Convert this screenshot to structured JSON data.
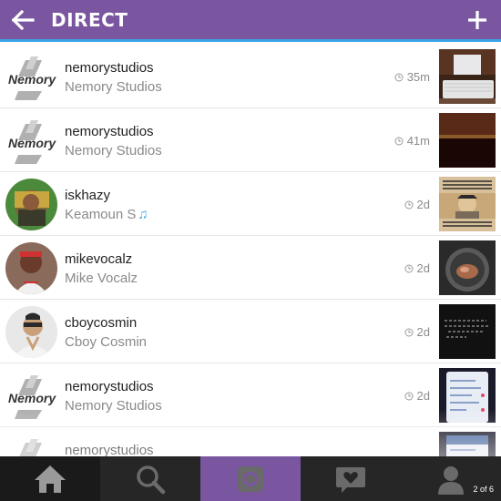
{
  "header": {
    "title": "DIRECT",
    "back_icon": "arrow-left-icon",
    "new_icon": "plus-icon",
    "bg_color": "#7a55a0",
    "accent_color": "#3aa3e3"
  },
  "threads": [
    {
      "username": "nemorystudios",
      "fullname": "Nemory Studios",
      "time": "35m",
      "avatar": "nemory-logo",
      "thumb": "desk-computer-photo"
    },
    {
      "username": "nemorystudios",
      "fullname": "Nemory Studios",
      "time": "41m",
      "avatar": "nemory-logo",
      "thumb": "dark-photo"
    },
    {
      "username": "iskhazy",
      "fullname": "Keamoun S",
      "time": "2d",
      "avatar": "profile-photo",
      "thumb": "meme-photo"
    },
    {
      "username": "mikevocalz",
      "fullname": "Mike Vocalz",
      "time": "2d",
      "avatar": "profile-photo",
      "thumb": "food-pan-photo"
    },
    {
      "username": "cboycosmin",
      "fullname": "Cboy Cosmin",
      "time": "2d",
      "avatar": "profile-photo",
      "thumb": "chalkboard-photo"
    },
    {
      "username": "nemorystudios",
      "fullname": "Nemory Studios",
      "time": "2d",
      "avatar": "nemory-logo",
      "thumb": "phone-screen-photo"
    },
    {
      "username": "nemorystudios",
      "fullname": "",
      "time": "",
      "avatar": "nemory-logo",
      "thumb": "phone-screen-photo"
    }
  ],
  "bottom_nav": {
    "tabs": [
      "home-icon",
      "search-icon",
      "camera-icon",
      "activity-heart-icon",
      "profile-icon"
    ],
    "page_indicator": "2 of 6"
  },
  "logo_text": "Nemory"
}
